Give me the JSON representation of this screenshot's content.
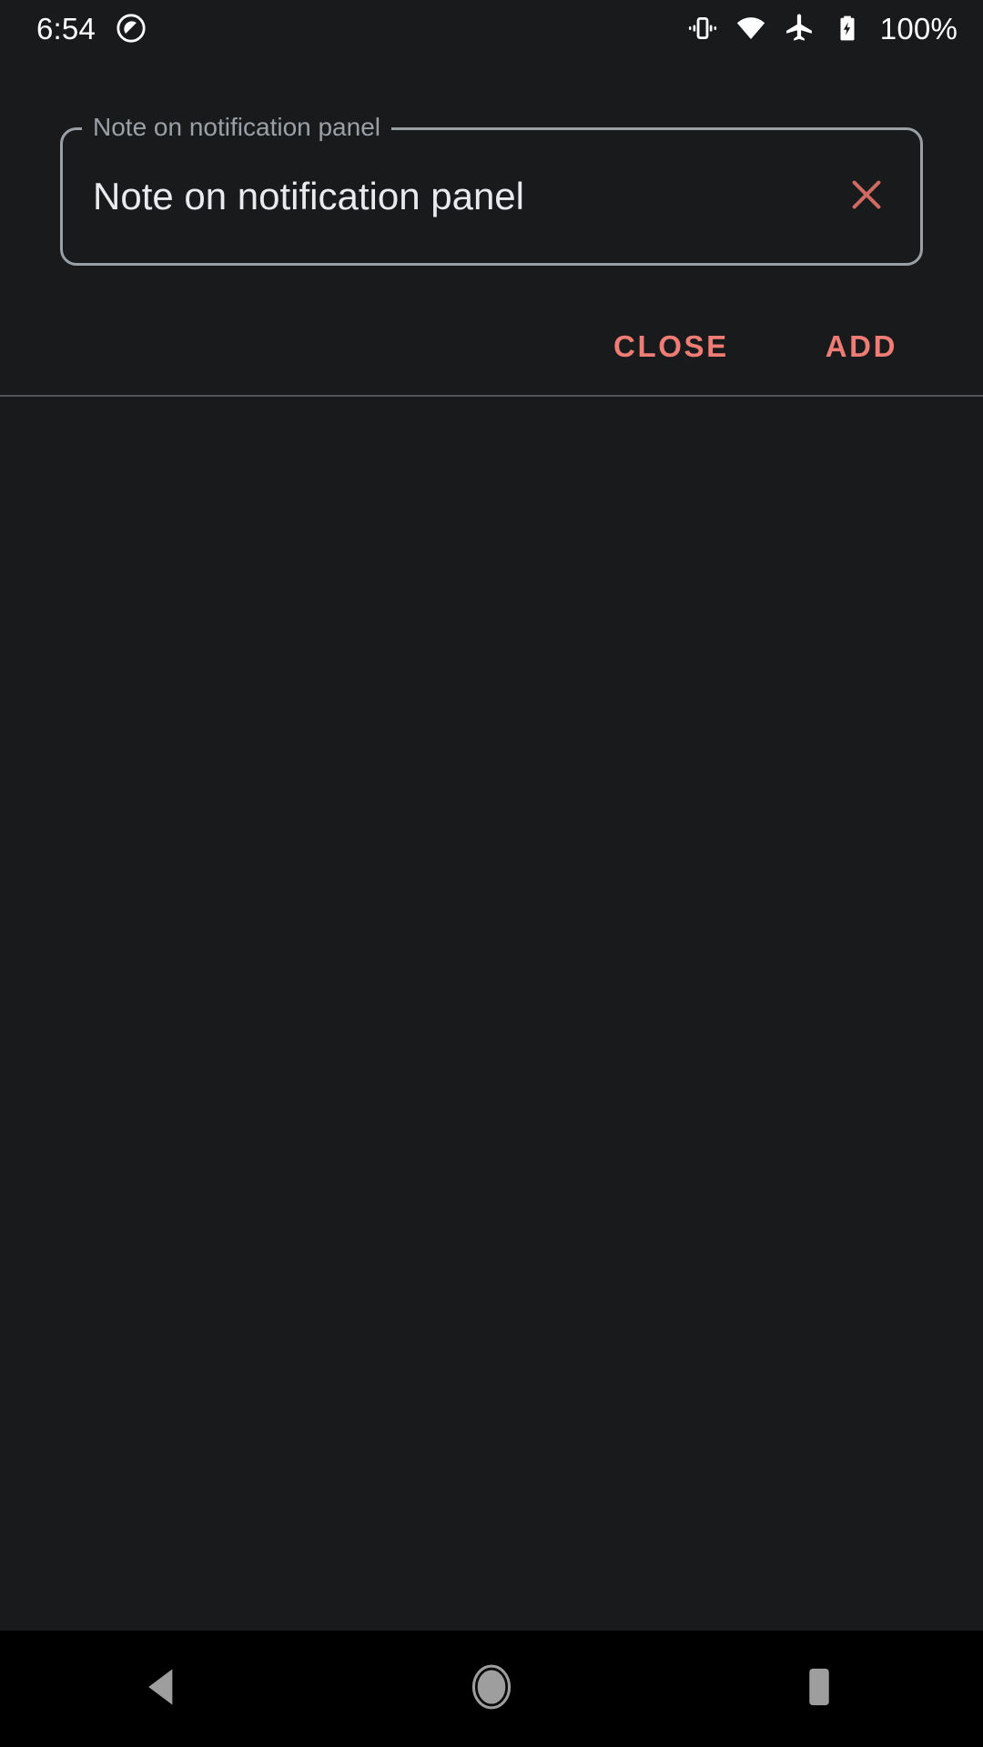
{
  "status_bar": {
    "clock": "6:54",
    "battery_percent": "100%",
    "icons": [
      {
        "name": "notification-silenced-icon",
        "position": "left"
      },
      {
        "name": "vibrate-icon",
        "position": "right"
      },
      {
        "name": "wifi-icon",
        "position": "right"
      },
      {
        "name": "airplane-mode-icon",
        "position": "right"
      },
      {
        "name": "battery-charging-icon",
        "position": "right"
      }
    ],
    "text_color": "#ffffff",
    "background": "#191a1c"
  },
  "dialog": {
    "text_field": {
      "label": "Note on notification panel",
      "value": "Note on notification panel",
      "placeholder": "Note on notification panel",
      "clear_icon": "close-icon",
      "outline_color": "#9aa0a6",
      "label_color": "#9aa0a6",
      "value_color": "#e8eaed",
      "clear_icon_color": "#cf6a63"
    },
    "actions": {
      "close_label": "CLOSE",
      "add_label": "ADD",
      "accent_color": "#ef7d76"
    }
  },
  "content": {
    "empty": true,
    "background": "#191a1c"
  },
  "nav_bar": {
    "background": "#000000",
    "icon_color": "#9e9e9e",
    "buttons": [
      {
        "name": "back-button",
        "icon": "back-triangle-icon"
      },
      {
        "name": "home-button",
        "icon": "home-circle-icon"
      },
      {
        "name": "recents-button",
        "icon": "recents-square-icon"
      }
    ]
  },
  "colors": {
    "background": "#191a1c",
    "divider": "#52565a",
    "accent": "#ef7d76",
    "nav_background": "#000000"
  }
}
